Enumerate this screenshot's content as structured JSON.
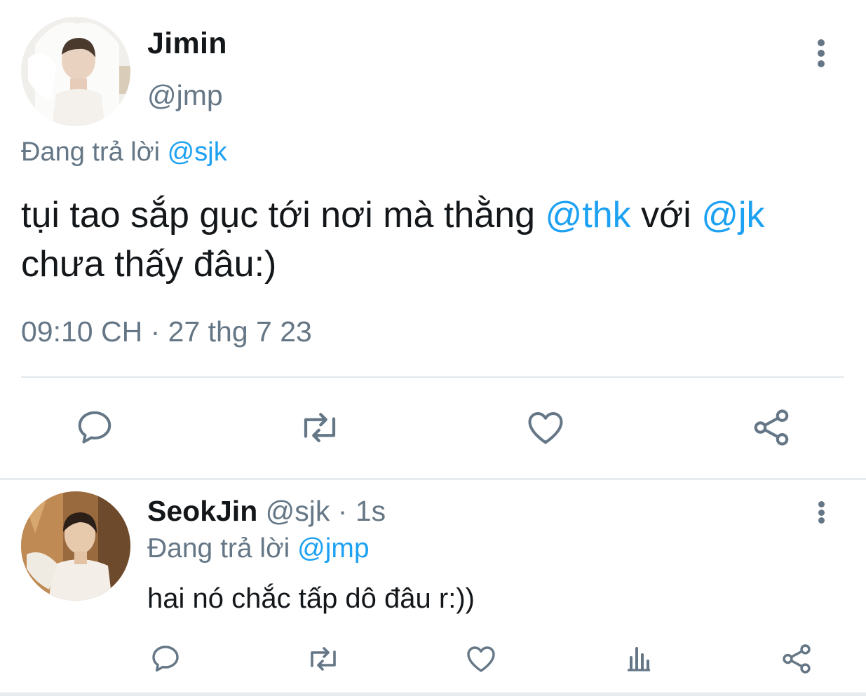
{
  "main_tweet": {
    "avatar_icon": "user-avatar-photo",
    "name": "Jimin",
    "handle": "@jmp",
    "replying_prefix": "Đang trả lời ",
    "replying_to": "@sjk",
    "text_part1": "tụi tao sắp gục tới nơi mà thằng ",
    "mention1": "@thk",
    "text_part2": " với ",
    "mention2": "@jk",
    "text_part3": " chưa thấy đâu:)",
    "timestamp": "09:10 CH · 27 thg 7 23",
    "actions": [
      "reply-icon",
      "retweet-icon",
      "like-icon",
      "share-icon"
    ]
  },
  "reply_tweet": {
    "avatar_icon": "user-avatar-photo",
    "name": "SeokJin",
    "handle": "@sjk",
    "separator": " · ",
    "age": "1s",
    "replying_prefix": "Đang trả lời ",
    "replying_to": "@jmp",
    "text": "hai nó chắc tấp dô đâu r:))",
    "actions": [
      "reply-icon",
      "retweet-icon",
      "like-icon",
      "stats-icon",
      "share-icon"
    ]
  },
  "colors": {
    "text_primary": "#14171a",
    "text_secondary": "#657786",
    "link": "#1da1f2",
    "divider": "#e1e8ed"
  }
}
